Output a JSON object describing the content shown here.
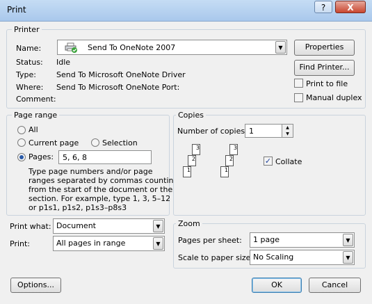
{
  "window": {
    "title": "Print",
    "help_label": "?",
    "close_label": "X"
  },
  "printer": {
    "group_label": "Printer",
    "name_label": "Name:",
    "name_value": "Send To OneNote 2007",
    "status_label": "Status:",
    "status_value": "Idle",
    "type_label": "Type:",
    "type_value": "Send To Microsoft OneNote Driver",
    "where_label": "Where:",
    "where_value": "Send To Microsoft OneNote Port:",
    "comment_label": "Comment:",
    "properties_label": "Properties",
    "find_printer_label": "Find Printer...",
    "print_to_file_label": "Print to file",
    "manual_duplex_label": "Manual duplex"
  },
  "page_range": {
    "group_label": "Page range",
    "all_label": "All",
    "current_page_label": "Current page",
    "selection_label": "Selection",
    "pages_label": "Pages:",
    "pages_value": "5, 6, 8",
    "help_lines": [
      "Type page numbers and/or page",
      "ranges separated by commas counting",
      "from the start of the document or the",
      "section. For example, type 1, 3, 5–12",
      "or p1s1, p1s2, p1s3–p8s3"
    ]
  },
  "copies": {
    "group_label": "Copies",
    "number_label": "Number of copies:",
    "number_value": "1",
    "collate_label": "Collate",
    "page_numbers": [
      "3",
      "2",
      "1"
    ]
  },
  "print_what": {
    "label": "Print what:",
    "value": "Document"
  },
  "print": {
    "label": "Print:",
    "value": "All pages in range"
  },
  "zoom": {
    "group_label": "Zoom",
    "pages_per_sheet_label": "Pages per sheet:",
    "pages_per_sheet_value": "1 page",
    "scale_label": "Scale to paper size:",
    "scale_value": "No Scaling"
  },
  "buttons": {
    "options_label": "Options...",
    "ok_label": "OK",
    "cancel_label": "Cancel"
  },
  "colors": {
    "title_bar": "#b7d1ef",
    "close_red": "#c9472f",
    "default_border": "#3c7fb1"
  },
  "state": {
    "page_range_selected": "pages",
    "collate_checked": true,
    "print_to_file_checked": false,
    "manual_duplex_checked": false
  }
}
